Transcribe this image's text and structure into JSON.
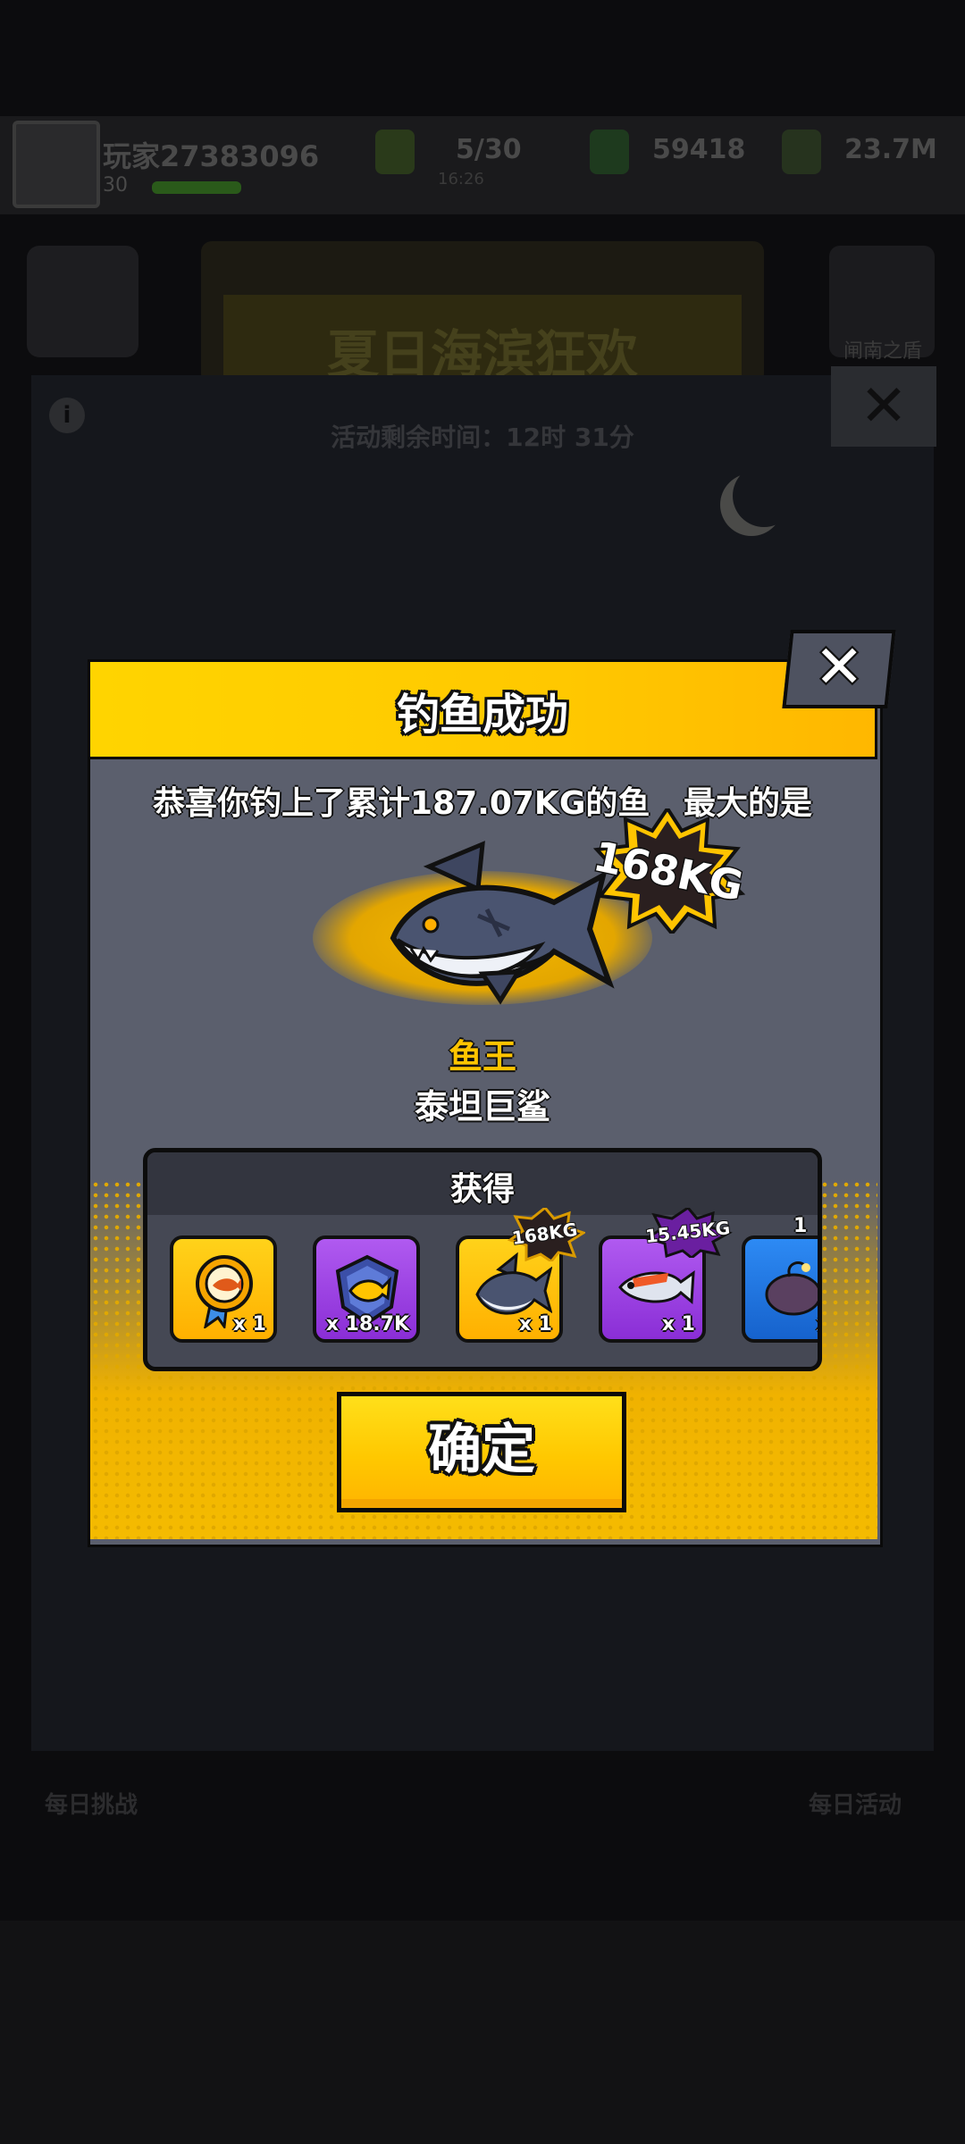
{
  "background": {
    "player_name": "玩家27383096",
    "player_level": "30",
    "stats": [
      "5/30",
      "59418",
      "23.7M"
    ],
    "stat_sub": "16:26",
    "event_title": "夏日海滨狂欢",
    "event_timer": "活动剩余时间：12时 31分",
    "guard_label": "闸南之盾",
    "nav_left": "每日挑战",
    "nav_right": "每日活动"
  },
  "dialog": {
    "title": "钓鱼成功",
    "close": "✕",
    "congrats": "恭喜你钓上了累计187.07KG的鱼   最大的是",
    "biggest_weight": "168KG",
    "fish_king_label": "鱼王",
    "fish_name": "泰坦巨鲨",
    "rewards_title": "获得",
    "rewards": [
      {
        "icon": "fish-medal-icon",
        "qty": "x 1",
        "bg": "#ffc400"
      },
      {
        "icon": "fish-token-icon",
        "qty": "x 18.7K",
        "bg": "#9a3ee0"
      },
      {
        "icon": "shark-icon",
        "qty": "x 1",
        "bg": "#ffc400",
        "tag": "168KG"
      },
      {
        "icon": "fish-icon",
        "qty": "x 1",
        "bg": "#9a3ee0",
        "tag": "15.45KG"
      },
      {
        "icon": "anglerfish-icon",
        "qty": "x",
        "bg": "#1e7de8",
        "tag": "1"
      }
    ],
    "confirm": "确定"
  }
}
